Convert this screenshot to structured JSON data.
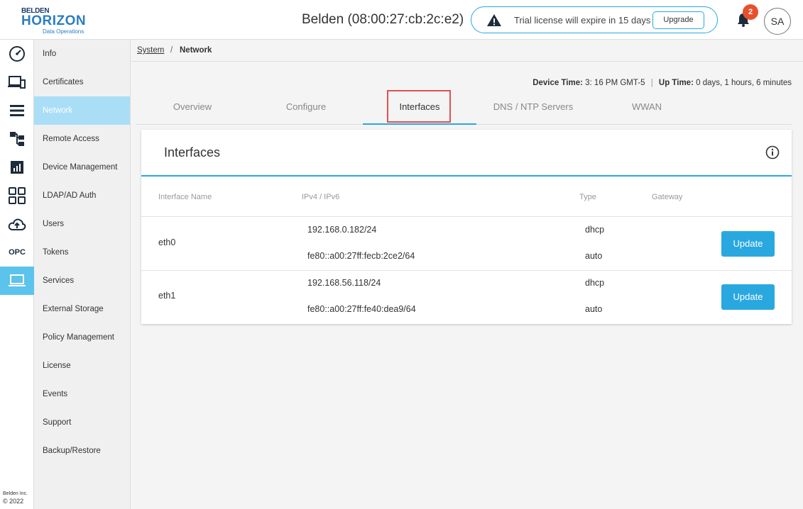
{
  "brand": {
    "line1": "BELDEN",
    "line2": "HORIZON",
    "line3": "Data Operations"
  },
  "header": {
    "device_title": "Belden (08:00:27:cb:2c:e2)",
    "trial_text": "Trial license will expire in 15 days",
    "upgrade_label": "Upgrade",
    "notification_count": "2",
    "avatar_initials": "SA"
  },
  "rail": {
    "icons": [
      "dashboard-icon",
      "devices-icon",
      "list-icon",
      "hierarchy-icon",
      "analytics-icon",
      "apps-grid-icon",
      "cloud-upload-icon",
      "opc-icon",
      "laptop-icon"
    ],
    "opc_label": "OPC",
    "active_index": 8,
    "footer_company": "Belden Inc.",
    "footer_year": "© 2022"
  },
  "sidebar": {
    "items": [
      {
        "label": "Info"
      },
      {
        "label": "Certificates"
      },
      {
        "label": "Network"
      },
      {
        "label": "Remote Access"
      },
      {
        "label": "Device Management"
      },
      {
        "label": "LDAP/AD Auth"
      },
      {
        "label": "Users"
      },
      {
        "label": "Tokens"
      },
      {
        "label": "Services"
      },
      {
        "label": "External Storage"
      },
      {
        "label": "Policy Management"
      },
      {
        "label": "License"
      },
      {
        "label": "Events"
      },
      {
        "label": "Support"
      },
      {
        "label": "Backup/Restore"
      }
    ],
    "active_index": 2
  },
  "breadcrumb": {
    "root": "System",
    "separator": "/",
    "current": "Network"
  },
  "device_info": {
    "time_label": "Device Time:",
    "time_value": "3: 16 PM GMT-5",
    "uptime_label": "Up Time:",
    "uptime_value": "0 days, 1 hours, 6 minutes"
  },
  "tabs": {
    "items": [
      {
        "label": "Overview"
      },
      {
        "label": "Configure"
      },
      {
        "label": "Interfaces"
      },
      {
        "label": "DNS / NTP Servers"
      },
      {
        "label": "WWAN"
      }
    ],
    "active_index": 2
  },
  "card": {
    "title": "Interfaces",
    "columns": [
      "Interface Name",
      "IPv4 / IPv6",
      "Type",
      "Gateway"
    ],
    "rows": [
      {
        "name": "eth0",
        "ipv4": "192.168.0.182/24",
        "ipv6": "fe80::a00:27ff:fecb:2ce2/64",
        "type_v4": "dhcp",
        "type_v6": "auto",
        "action": "Update"
      },
      {
        "name": "eth1",
        "ipv4": "192.168.56.118/24",
        "ipv6": "fe80::a00:27ff:fe40:dea9/64",
        "type_v4": "dhcp",
        "type_v6": "auto",
        "action": "Update"
      }
    ]
  },
  "colors": {
    "accent": "#29a8e0",
    "active_rail": "#5bc3ec",
    "active_sidebar": "#a9def6",
    "badge": "#e8502d",
    "highlight_box": "#e05050"
  }
}
